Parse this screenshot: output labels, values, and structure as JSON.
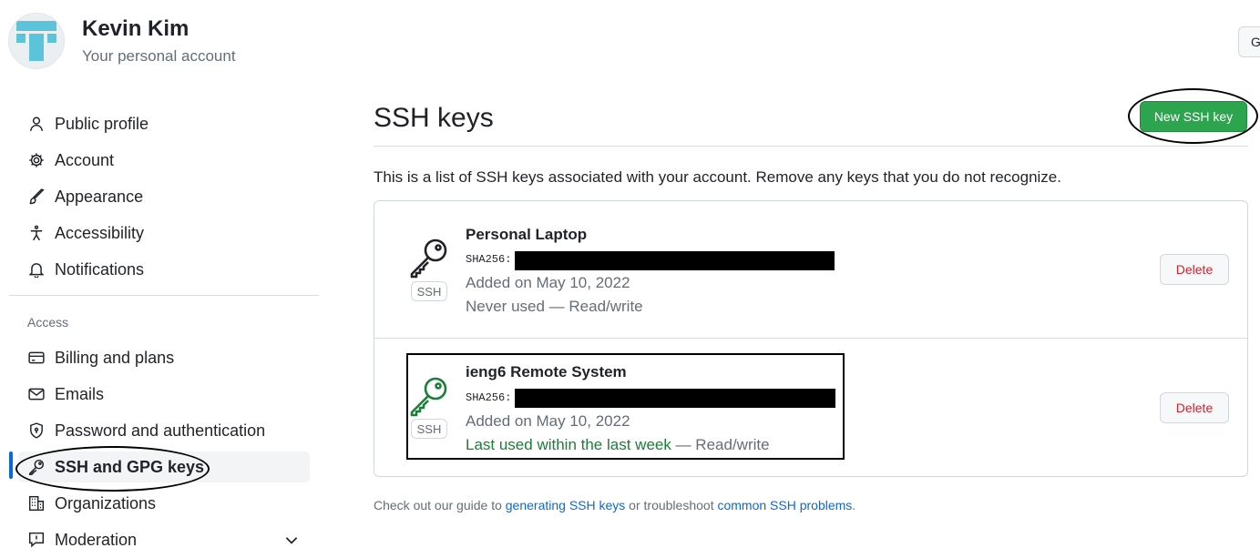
{
  "header": {
    "user_name": "Kevin Kim",
    "user_subtitle": "Your personal account",
    "go_button_label": "G"
  },
  "sidebar": {
    "items": [
      {
        "label": "Public profile",
        "icon": "person-icon"
      },
      {
        "label": "Account",
        "icon": "gear-icon"
      },
      {
        "label": "Appearance",
        "icon": "paintbrush-icon"
      },
      {
        "label": "Accessibility",
        "icon": "accessibility-icon"
      },
      {
        "label": "Notifications",
        "icon": "bell-icon"
      }
    ],
    "access_heading": "Access",
    "access_items": [
      {
        "label": "Billing and plans",
        "icon": "credit-card-icon"
      },
      {
        "label": "Emails",
        "icon": "mail-icon"
      },
      {
        "label": "Password and authentication",
        "icon": "shield-lock-icon"
      },
      {
        "label": "SSH and GPG keys",
        "icon": "key-icon",
        "active": true
      },
      {
        "label": "Organizations",
        "icon": "organization-icon"
      },
      {
        "label": "Moderation",
        "icon": "report-icon",
        "expandable": true
      }
    ]
  },
  "main": {
    "title": "SSH keys",
    "new_key_button": "New SSH key",
    "intro": "This is a list of SSH keys associated with your account. Remove any keys that you do not recognize.",
    "keys": [
      {
        "title": "Personal Laptop",
        "sha_label": "SHA256:",
        "added": "Added on May 10, 2022",
        "usage_prefix": "Never used",
        "usage_suffix": " — Read/write",
        "badge": "SSH",
        "delete_label": "Delete",
        "recently_used": false,
        "icon_color": "#1f2328"
      },
      {
        "title": "ieng6 Remote System",
        "sha_label": "SHA256:",
        "added": "Added on May 10, 2022",
        "usage_prefix": "Last used within the last week",
        "usage_suffix": " — Read/write",
        "badge": "SSH",
        "delete_label": "Delete",
        "recently_used": true,
        "icon_color": "#1a7f37"
      }
    ],
    "footer": {
      "text1": "Check out our guide to ",
      "link1": "generating SSH keys",
      "text2": " or troubleshoot ",
      "link2": "common SSH problems",
      "text3": "."
    }
  },
  "colors": {
    "accent_green": "#2da44e",
    "link_blue": "#0969da",
    "danger_red": "#cf222e",
    "used_green": "#1a7f37"
  }
}
